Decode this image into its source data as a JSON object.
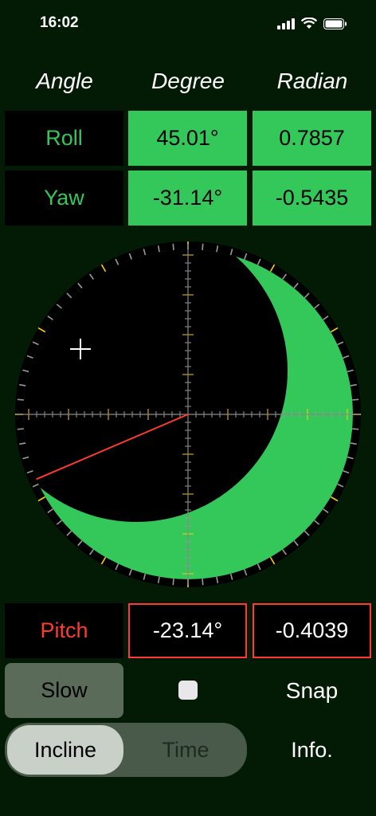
{
  "status": {
    "time": "16:02"
  },
  "headers": {
    "angle": "Angle",
    "degree": "Degree",
    "radian": "Radian"
  },
  "rows": {
    "roll": {
      "label": "Roll",
      "degree": "45.01°",
      "radian": "0.7857"
    },
    "yaw": {
      "label": "Yaw",
      "degree": "-31.14°",
      "radian": "-0.5435"
    },
    "pitch": {
      "label": "Pitch",
      "degree": "-23.14°",
      "radian": "-0.4039"
    }
  },
  "gauge": {
    "line_angle_deg": 23.14
  },
  "controls": {
    "slow_label": "Slow",
    "snap_label": "Snap",
    "segments": [
      "Incline",
      "Time"
    ],
    "active_segment": "Incline",
    "info_label": "Info."
  },
  "colors": {
    "accent": "#34c759",
    "warning": "#ff3b30",
    "tick_minor": "#9a9a9a",
    "tick_major": "#ffcc00"
  },
  "icons": {
    "signal": "signal-icon",
    "wifi": "wifi-icon",
    "battery": "battery-icon",
    "crosshair": "crosshair-icon"
  }
}
